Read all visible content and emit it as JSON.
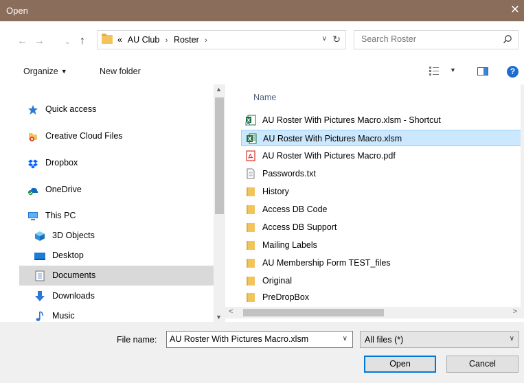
{
  "window": {
    "title": "Open",
    "close_glyph": "✕"
  },
  "address": {
    "crumbs": [
      "«",
      "AU Club",
      "Roster"
    ],
    "search_placeholder": "Search Roster"
  },
  "toolbar": {
    "organize_label": "Organize",
    "new_folder_label": "New folder"
  },
  "nav": {
    "items": [
      {
        "label": "Quick access",
        "icon": "star-icon"
      },
      {
        "label": "Creative Cloud Files",
        "icon": "creative-cloud-icon"
      },
      {
        "label": "Dropbox",
        "icon": "dropbox-icon"
      },
      {
        "label": "OneDrive",
        "icon": "onedrive-icon"
      },
      {
        "label": "This PC",
        "icon": "computer-icon"
      },
      {
        "label": "3D Objects",
        "icon": "cube-icon"
      },
      {
        "label": "Desktop",
        "icon": "desktop-icon"
      },
      {
        "label": "Documents",
        "icon": "documents-icon",
        "selected": true
      },
      {
        "label": "Downloads",
        "icon": "download-arrow-icon"
      },
      {
        "label": "Music",
        "icon": "music-note-icon"
      }
    ]
  },
  "files": {
    "column_name": "Name",
    "items": [
      {
        "label": "AU Roster With Pictures Macro.xlsm - Shortcut",
        "icon": "excel-shortcut-icon"
      },
      {
        "label": "AU Roster With Pictures Macro.xlsm",
        "icon": "excel-icon",
        "selected": true
      },
      {
        "label": "AU Roster With Pictures Macro.pdf",
        "icon": "pdf-icon"
      },
      {
        "label": "Passwords.txt",
        "icon": "text-file-icon"
      },
      {
        "label": "History",
        "icon": "folder-icon"
      },
      {
        "label": "Access DB Code",
        "icon": "folder-icon"
      },
      {
        "label": "Access DB Support",
        "icon": "folder-icon"
      },
      {
        "label": "Mailing Labels",
        "icon": "folder-icon"
      },
      {
        "label": "AU Membership Form TEST_files",
        "icon": "folder-icon"
      },
      {
        "label": "Original",
        "icon": "folder-icon"
      },
      {
        "label": "PreDropBox",
        "icon": "folder-icon"
      }
    ]
  },
  "bottom": {
    "file_name_label": "File name:",
    "file_name_value": "AU Roster With Pictures Macro.xlsm",
    "file_type_value": "All files (*)",
    "open_label": "Open",
    "cancel_label": "Cancel"
  },
  "colors": {
    "titlebar": "#8a6d5a",
    "selection": "#cce8ff",
    "accent": "#0078d7"
  }
}
